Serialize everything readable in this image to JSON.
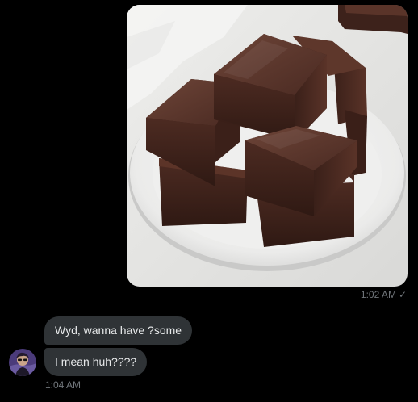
{
  "sent_message": {
    "image_alt": "Chocolate fudge squares stacked on a white plate",
    "time": "1:02 AM",
    "read_icon": "check-icon"
  },
  "received_messages": [
    {
      "text": "Wyd, wanna have ?some"
    },
    {
      "text": "I mean huh????"
    }
  ],
  "received_time": "1:04 AM",
  "colors": {
    "background": "#000000",
    "bubble": "#2f3336",
    "text": "#e7e9ea",
    "meta": "#71767b"
  }
}
